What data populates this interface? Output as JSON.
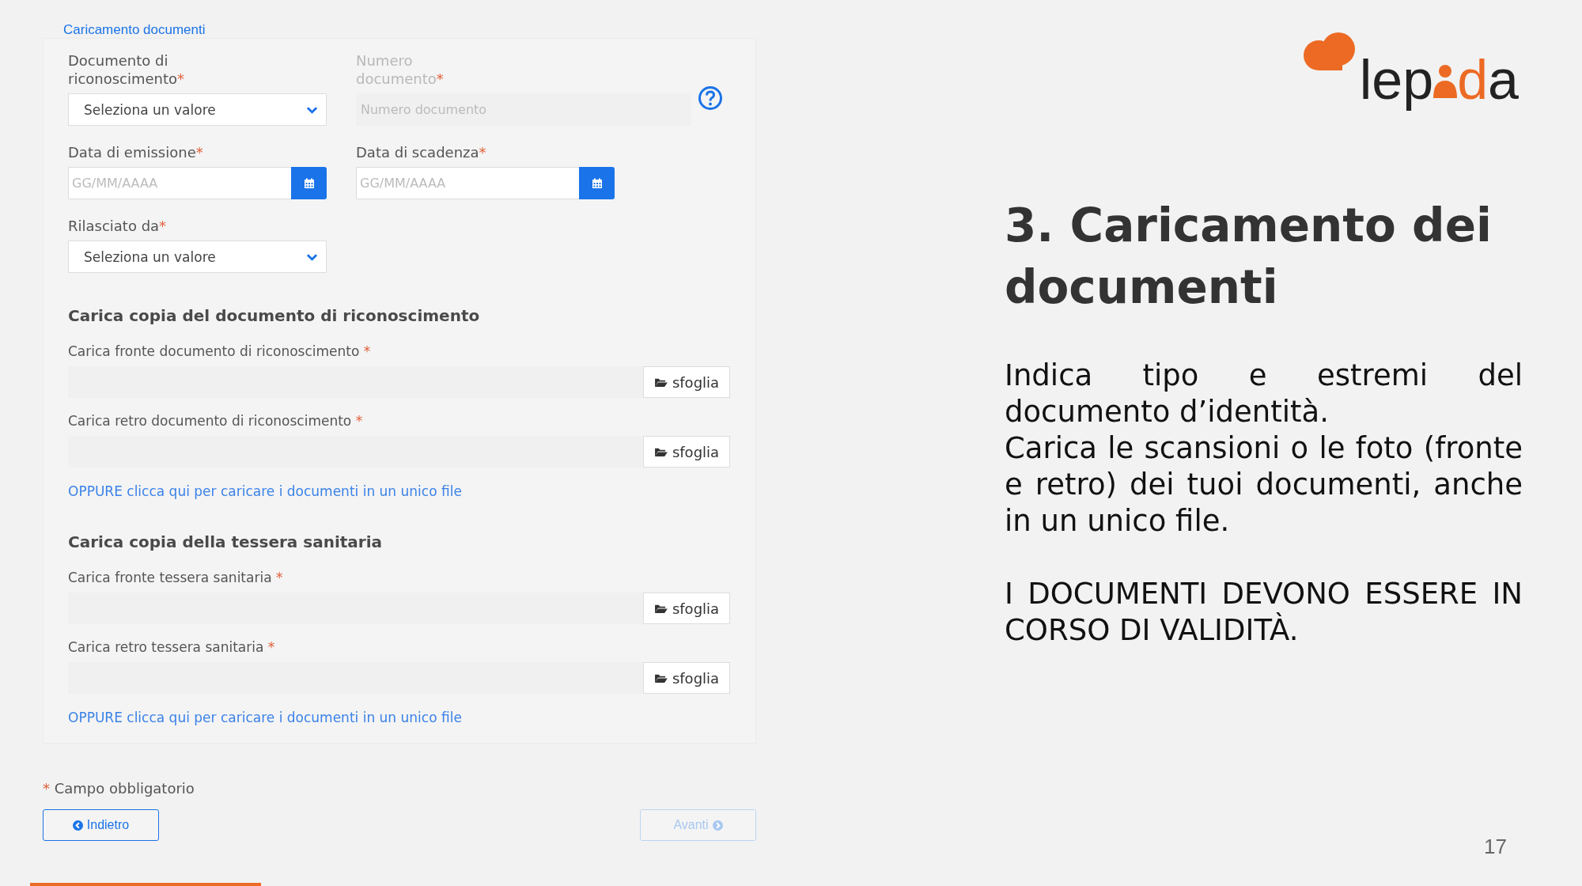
{
  "form": {
    "title": "Caricamento documenti",
    "fields": [
      {
        "kind": "select",
        "label": "Documento di riconoscimento",
        "mark": "*",
        "value": "Seleziona un valore",
        "disabled": false,
        "help": false
      },
      {
        "kind": "text",
        "label": "Numero documento",
        "mark": "*",
        "placeholder": "Numero documento",
        "disabled": true,
        "help": true
      },
      {
        "kind": "date",
        "label": "Data di emissione",
        "mark": "*",
        "placeholder": "GG/MM/AAAA",
        "disabled": false,
        "help": false
      },
      {
        "kind": "date",
        "label": "Data di scadenza",
        "mark": "*",
        "placeholder": "GG/MM/AAAA",
        "disabled": false,
        "help": false
      },
      {
        "kind": "select",
        "label": "Rilasciato da",
        "mark": "*",
        "value": "Seleziona un valore",
        "disabled": false,
        "help": false
      }
    ],
    "sections": [
      {
        "title": "Carica copia del documento di riconoscimento",
        "uploads": [
          {
            "label": "Carica fronte documento di riconoscimento",
            "mark": "*",
            "button": "sfoglia"
          },
          {
            "label": "Carica retro documento di riconoscimento",
            "mark": "*",
            "button": "sfoglia"
          }
        ],
        "link": "OPPURE clicca qui per caricare i documenti in un unico file"
      },
      {
        "title": "Carica copia della tessera sanitaria",
        "uploads": [
          {
            "label": "Carica fronte tessera sanitaria",
            "mark": "*",
            "button": "sfoglia"
          },
          {
            "label": "Carica retro tessera sanitaria",
            "mark": "*",
            "button": "sfoglia"
          }
        ],
        "link": "OPPURE clicca qui per caricare i documenti in un unico file"
      }
    ],
    "footnote": {
      "mark": "*",
      "text": "Campo obbligatorio"
    },
    "buttons": [
      {
        "kind": "back",
        "label": "Indietro",
        "disabled": false
      },
      {
        "kind": "next",
        "label": "Avanti",
        "disabled": true
      }
    ]
  },
  "slide": {
    "logo": {
      "text_start": "lep",
      "text_end": "da"
    },
    "heading": "3. Caricamento dei documenti",
    "text_blocks": [
      [
        "Indica tipo e estremi del documento d’identità.",
        "Carica le scansioni o le foto (fronte e retro) dei tuoi documenti, anche in un unico file."
      ],
      [
        "I DOCUMENTI DEVONO ESSERE IN CORSO DI VALIDITÀ."
      ]
    ],
    "page_number": "17"
  }
}
